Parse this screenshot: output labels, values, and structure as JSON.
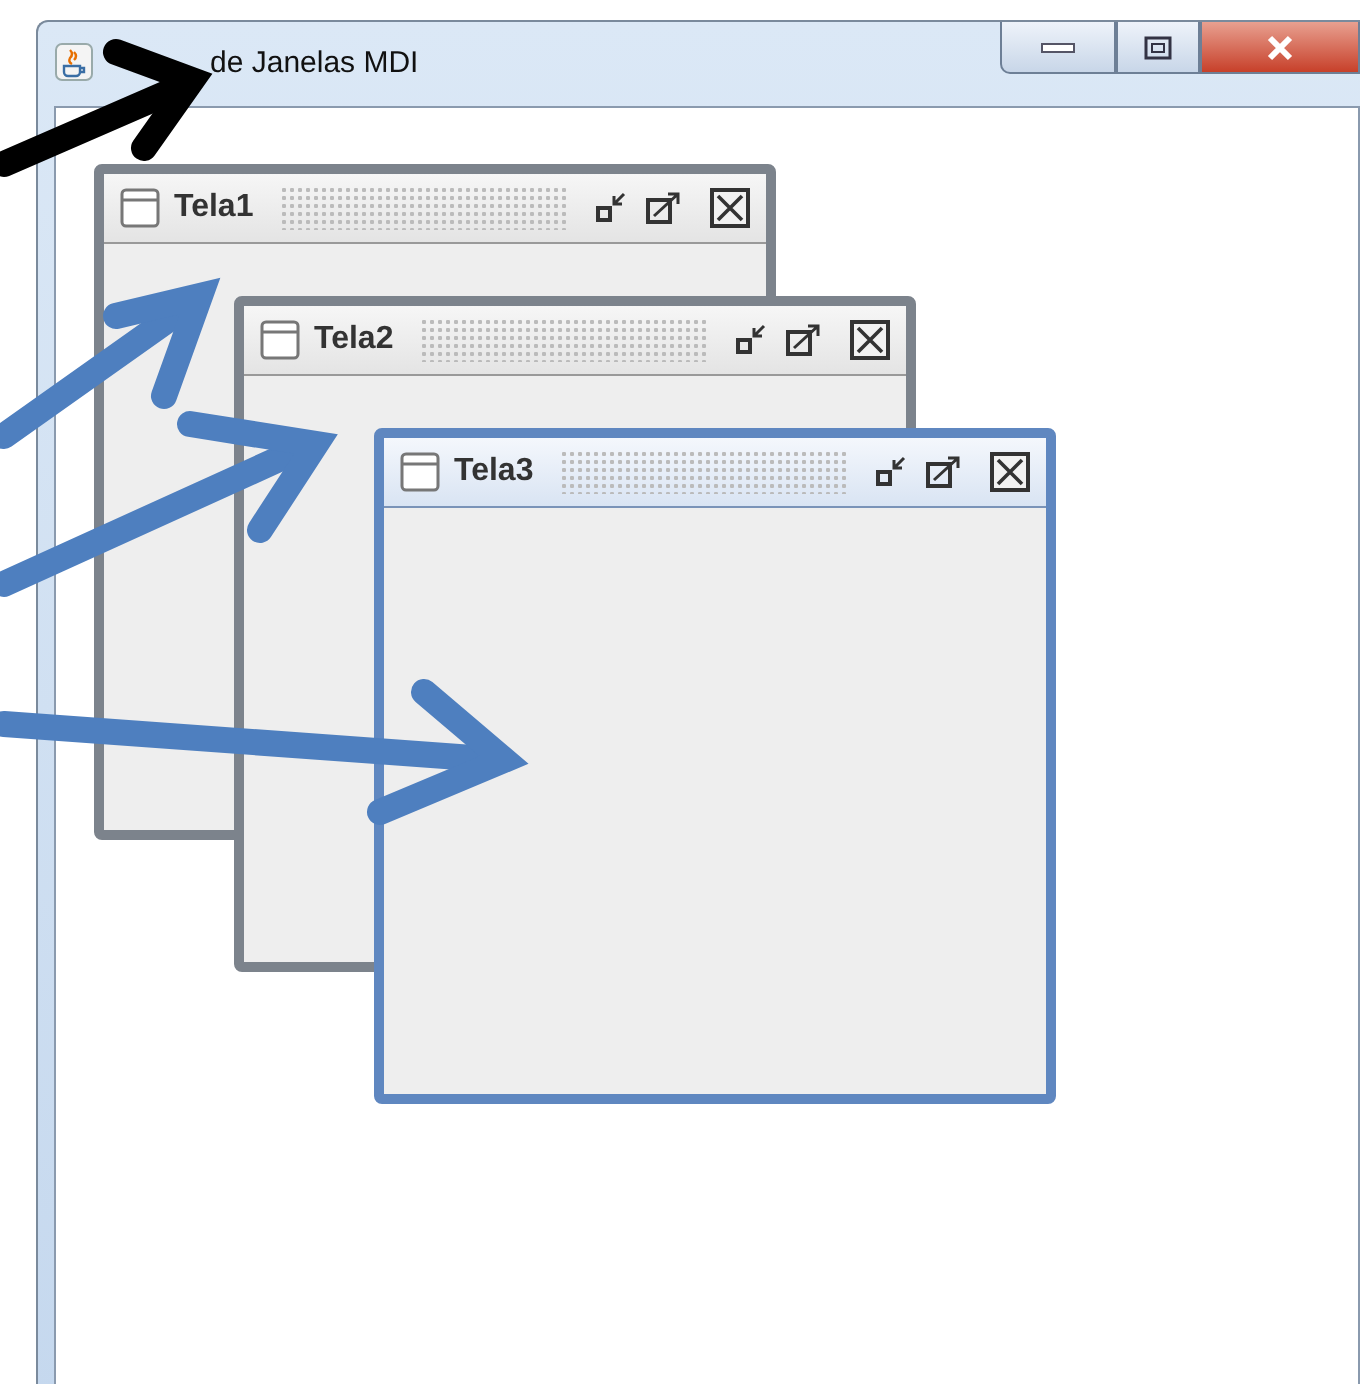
{
  "window": {
    "title": "de Janelas MDI"
  },
  "internal_frames": [
    {
      "title": "Tela1",
      "selected": false
    },
    {
      "title": "Tela2",
      "selected": false
    },
    {
      "title": "Tela3",
      "selected": true
    }
  ]
}
